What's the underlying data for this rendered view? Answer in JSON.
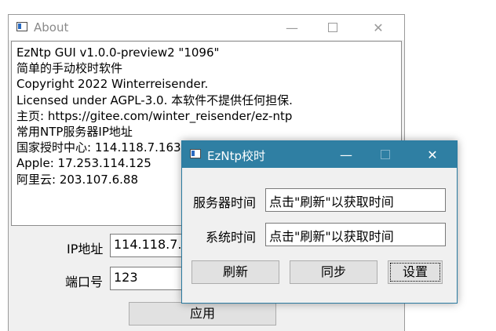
{
  "about": {
    "title": "About",
    "controls": {
      "minimize": "—",
      "close": "✕"
    },
    "lines": [
      "EzNtp GUI v1.0.0-preview2 \"1096\"",
      "简单的手动校时软件",
      "Copyright 2022 Winterreisender.",
      "Licensed under AGPL-3.0. 本软件不提供任何担保.",
      "主页: https://gitee.com/winter_reisender/ez-ntp",
      "常用NTP服务器IP地址",
      "国家授时中心: 114.118.7.163",
      "Apple: 17.253.114.125",
      "阿里云: 203.107.6.88"
    ],
    "ip_label": "IP地址",
    "ip_value": "114.118.7.163",
    "port_label": "端口号",
    "port_value": "123",
    "apply_label": "应用"
  },
  "ntp": {
    "title": "EzNtp校时",
    "controls": {
      "minimize": "—",
      "close": "✕"
    },
    "server_time_label": "服务器时间",
    "server_time_value": "点击\"刷新\"以获取时间",
    "system_time_label": "系统时间",
    "system_time_value": "点击\"刷新\"以获取时间",
    "refresh_label": "刷新",
    "sync_label": "同步",
    "settings_label": "设置"
  }
}
